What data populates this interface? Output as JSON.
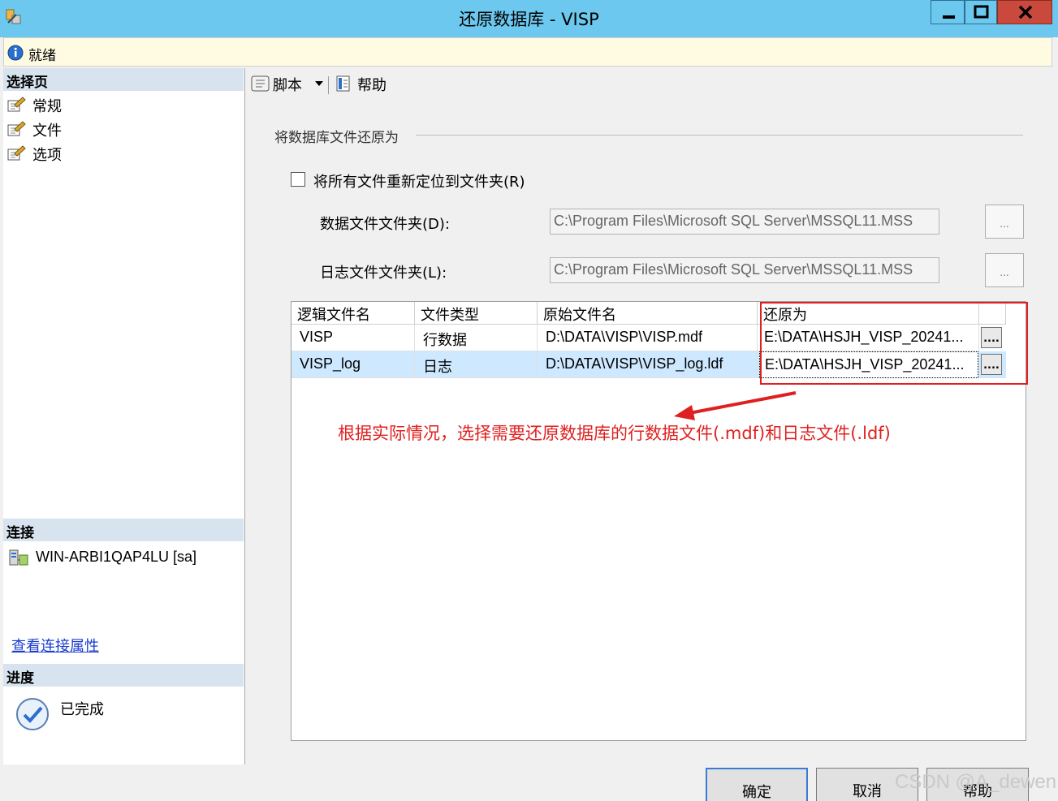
{
  "window": {
    "title": "还原数据库 - VISP",
    "status": "就绪"
  },
  "left_panel": {
    "select_page_header": "选择页",
    "pages": [
      {
        "label": "常规"
      },
      {
        "label": "文件"
      },
      {
        "label": "选项"
      }
    ],
    "connection_header": "连接",
    "connection_name": "WIN-ARBI1QAP4LU [sa]",
    "view_connection_link": "查看连接属性",
    "progress_header": "进度",
    "progress_status": "已完成"
  },
  "toolbar": {
    "script_label": "脚本",
    "help_label": "帮助"
  },
  "files_section": {
    "group_title": "将数据库文件还原为",
    "relocate_checkbox_label": "将所有文件重新定位到文件夹(R)",
    "relocate_checked": false,
    "data_folder_label": "数据文件文件夹(D):",
    "data_folder_value": "C:\\Program Files\\Microsoft SQL Server\\MSSQL11.MSS",
    "log_folder_label": "日志文件文件夹(L):",
    "log_folder_value": "C:\\Program Files\\Microsoft SQL Server\\MSSQL11.MSS",
    "browse_label": "..."
  },
  "grid": {
    "columns": [
      "逻辑文件名",
      "文件类型",
      "原始文件名",
      "还原为"
    ],
    "rows": [
      {
        "logical": "VISP",
        "type": "行数据",
        "original": "D:\\DATA\\VISP\\VISP.mdf",
        "restore_as": "E:\\DATA\\HSJH_VISP_20241..."
      },
      {
        "logical": "VISP_log",
        "type": "日志",
        "original": "D:\\DATA\\VISP\\VISP_log.ldf",
        "restore_as": "E:\\DATA\\HSJH_VISP_20241..."
      }
    ],
    "cell_button_label": "...."
  },
  "annotation": "根据实际情况，选择需要还原数据库的行数据文件(.mdf)和日志文件(.ldf)",
  "buttons": {
    "ok": "确定",
    "cancel": "取消",
    "help": "帮助"
  },
  "watermark": "CSDN @A_dewen",
  "colors": {
    "titlebar": "#6cc8ee",
    "annotation_red": "#e02020",
    "selected_row": "#cde8ff",
    "link_blue": "#1a3ccf"
  }
}
